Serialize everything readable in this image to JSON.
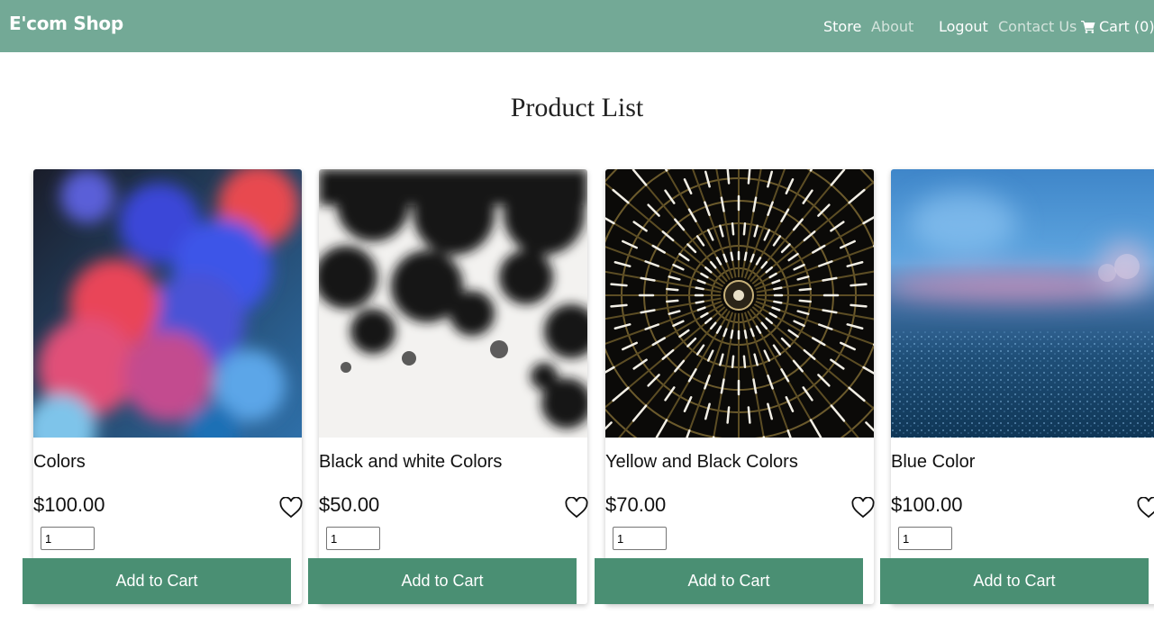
{
  "brand": "E'com Shop",
  "nav": {
    "store": "Store",
    "about": "About",
    "logout": "Logout",
    "contact": "Contact Us",
    "cart": "Cart (0)",
    "cart_icon": "shopping-cart-icon"
  },
  "title": "Product List",
  "colors": {
    "navbar": "#73a996",
    "button": "#4a8f73"
  },
  "products": [
    {
      "name": "Colors",
      "price": "$100.00",
      "qty": "1",
      "button": "Add to Cart",
      "image": "red-blue-smoke"
    },
    {
      "name": "Black and white Colors",
      "price": "$50.00",
      "qty": "1",
      "button": "Add to Cart",
      "image": "black-ink"
    },
    {
      "name": "Yellow and Black Colors",
      "price": "$70.00",
      "qty": "1",
      "button": "Add to Cart",
      "image": "radial-lights"
    },
    {
      "name": "Blue Color",
      "price": "$100.00",
      "qty": "1",
      "button": "Add to Cart",
      "image": "blue-bokeh"
    }
  ]
}
